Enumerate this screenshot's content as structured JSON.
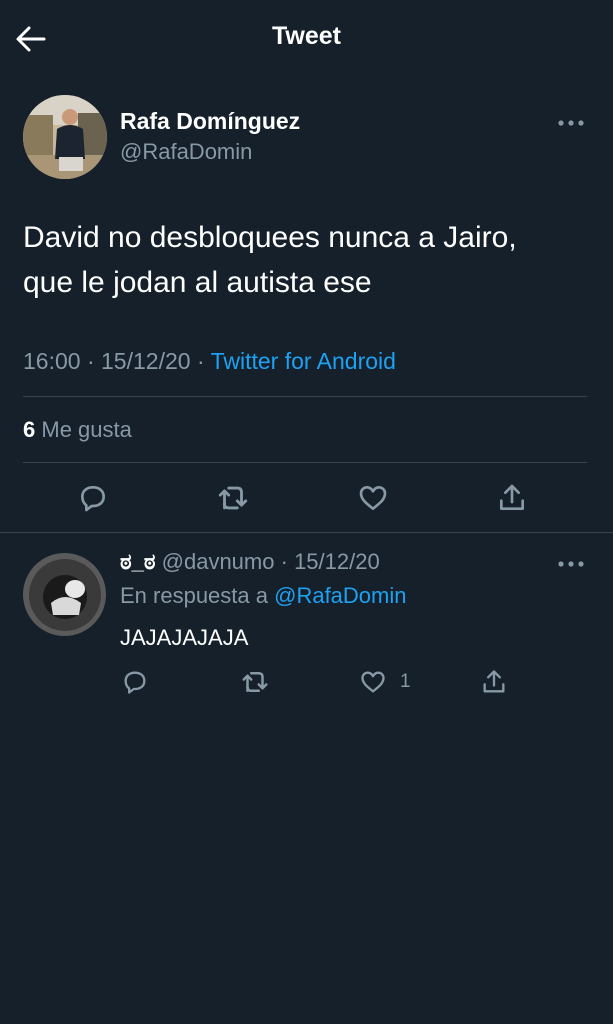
{
  "header": {
    "title": "Tweet"
  },
  "tweet": {
    "author_name": "Rafa Domínguez",
    "author_handle": "@RafaDomin",
    "text_line1": "David no desbloquees nunca a Jairo,",
    "text_line2": "que le jodan al autista ese",
    "time": "16:00",
    "date": "15/12/20",
    "source": "Twitter for Android",
    "likes_count": "6",
    "likes_label": "Me gusta"
  },
  "reply": {
    "author_name": "ಠ_ಠ",
    "author_handle": "@davnumo",
    "date": "15/12/20",
    "replying_prefix": "En respuesta a",
    "replying_to": "@RafaDomin",
    "text": "JAJAJAJAJA",
    "likes": "1"
  },
  "icons": [
    "back-arrow-icon",
    "more-icon",
    "reply-icon",
    "retweet-icon",
    "like-icon",
    "share-icon"
  ],
  "colors": {
    "background": "#15202b",
    "link": "#1da1f2",
    "muted": "#8899a6",
    "divider": "#38444d"
  }
}
